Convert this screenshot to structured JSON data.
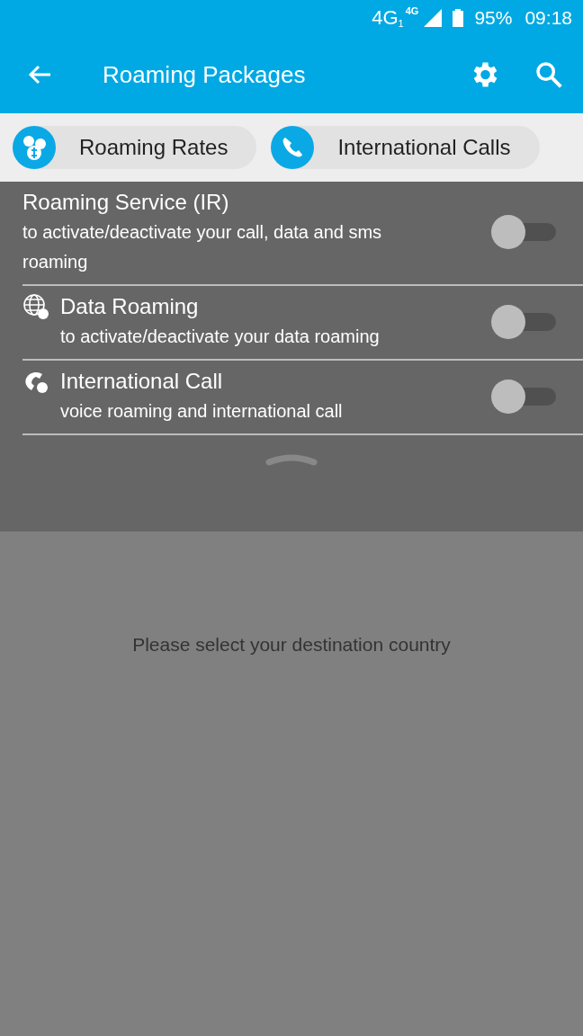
{
  "status_bar": {
    "network": "4G",
    "sim": "1",
    "network_2": "4G",
    "battery": "95%",
    "time": "09:18"
  },
  "app_bar": {
    "title": "Roaming Packages"
  },
  "tabs": [
    {
      "label": "Roaming Rates",
      "selected": false
    },
    {
      "label": "International Calls",
      "selected": false
    }
  ],
  "settings": [
    {
      "kind": "service",
      "title": "Roaming Service (IR)",
      "subtitle": "to activate/deactivate your call, data and sms roaming",
      "on": false
    },
    {
      "kind": "data",
      "title": "Data Roaming",
      "subtitle": "to activate/deactivate your data roaming",
      "on": false
    },
    {
      "kind": "call",
      "title": "International Call",
      "subtitle": "voice roaming and international call",
      "on": false
    }
  ],
  "message": "Please select your destination country"
}
